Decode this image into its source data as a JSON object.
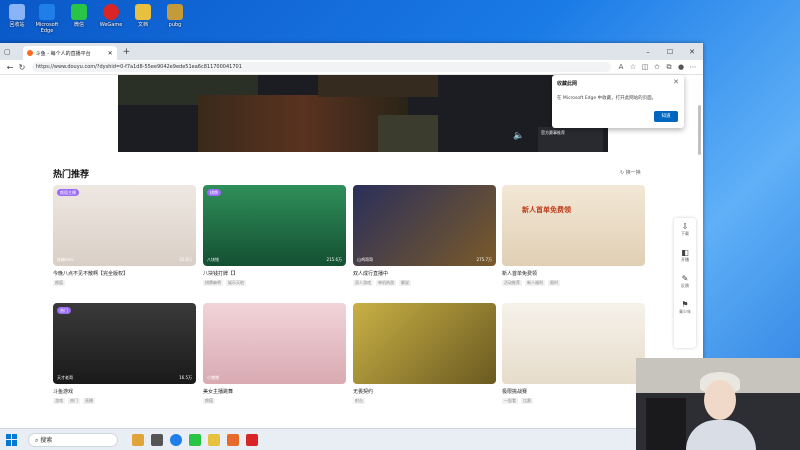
{
  "desktop": {
    "icons": [
      {
        "label": "回收站",
        "color": "#8ab4f8"
      },
      {
        "label": "Microsoft Edge",
        "color": "#1f7ee8"
      },
      {
        "label": "微信",
        "color": "#28c445"
      },
      {
        "label": "WeGame",
        "color": "#d92525"
      },
      {
        "label": "文档",
        "color": "#e8c040"
      },
      {
        "label": "pubg",
        "color": "#c59a3a"
      }
    ]
  },
  "browser": {
    "tab_title": "斗鱼 - 每个人的直播平台",
    "new_tab": "+",
    "url": "https://www.douyu.com/?dyshid=0-f7a1d8-55ee9042e9ede51ea6c811700041701",
    "window_controls": {
      "minimize": "–",
      "maximize": "☐",
      "close": "✕"
    }
  },
  "popup": {
    "title": "收藏此网",
    "body": "在 Microsoft Edge 中收藏，打开此网站的页面。",
    "button": "知道",
    "close": "✕"
  },
  "page": {
    "banner": {
      "live_tag": "官方赛事推荐"
    },
    "section_title": "热门推荐",
    "refresh_label": "换一换",
    "cards": [
      {
        "thumb_color": "#e8e1da",
        "badge": "颜值主播",
        "streamer": "妖精mini",
        "viewers": "35.8万",
        "title": "今晚八点不见不散啊【完全版权】",
        "tags": [
          "颜值"
        ]
      },
      {
        "thumb_color": "#1f6b3e",
        "badge": "棋牌",
        "streamer": "八块钱",
        "viewers": "215.6万",
        "title": "八块钱打牌【】",
        "tags": [
          "棋牌麻将",
          "娱乐天地"
        ]
      },
      {
        "thumb_color": "#2a2f5a",
        "badge": "",
        "streamer": "山鸡哥哥",
        "viewers": "275.7万",
        "title": "双人成行直播中",
        "tags": [
          "双人游戏",
          "单机热游",
          "解说"
        ]
      },
      {
        "thumb_color": "#efe3d0",
        "badge": "",
        "streamer": "",
        "viewers": "",
        "title": "新人首单免费领",
        "tags": [
          "活动推荐",
          "新人福利",
          "限时"
        ]
      },
      {
        "thumb_color": "#2b2b2b",
        "badge": "热门",
        "streamer": "天才老哥",
        "viewers": "16.5万",
        "title": "斗鱼游戏",
        "tags": [
          "游戏",
          "热门",
          "直播"
        ]
      },
      {
        "thumb_color": "#efc9d0",
        "badge": "",
        "streamer": "小猪猪",
        "viewers": "",
        "title": "美女主播跳舞",
        "tags": [
          "颜值"
        ]
      },
      {
        "thumb_color": "#c7a93a",
        "badge": "",
        "streamer": "",
        "viewers": "",
        "title": "无畏契约",
        "tags": [
          "射击"
        ]
      },
      {
        "thumb_color": "#f4f0e8",
        "badge": "",
        "streamer": "",
        "viewers": "",
        "title": "极限挑战赛",
        "tags": [
          "一起看",
          "比赛"
        ]
      }
    ]
  },
  "side_rail": [
    {
      "icon": "⇩",
      "label": "下载"
    },
    {
      "icon": "◧",
      "label": "开播"
    },
    {
      "icon": "✎",
      "label": "反馈"
    },
    {
      "icon": "⚑",
      "label": "青少年"
    }
  ],
  "taskbar": {
    "search_placeholder": "搜索"
  }
}
